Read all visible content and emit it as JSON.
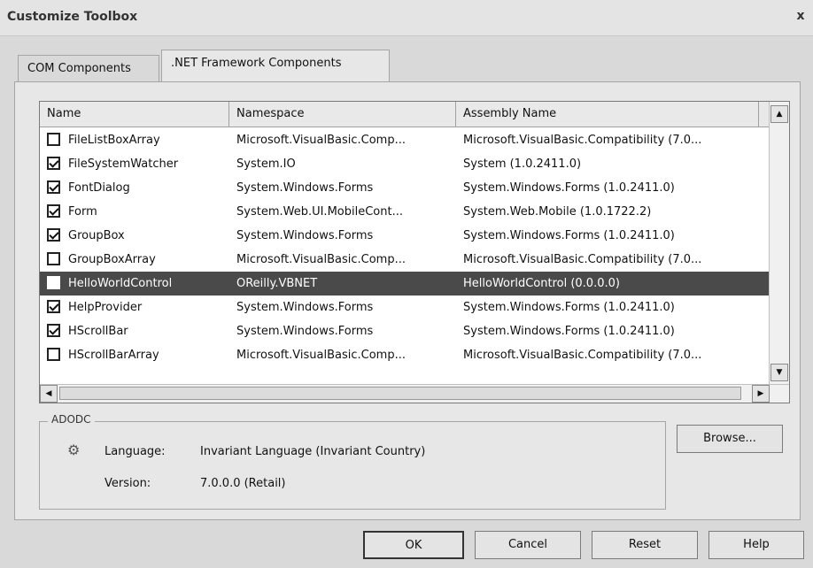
{
  "window": {
    "title": "Customize Toolbox",
    "close_glyph": "x"
  },
  "tabs": [
    {
      "label": "COM Components"
    },
    {
      "label": ".NET Framework Components"
    }
  ],
  "columns": [
    "Name",
    "Namespace",
    "Assembly Name"
  ],
  "rows": [
    {
      "checked": false,
      "selected": false,
      "name": "FileListBoxArray",
      "namespace": "Microsoft.VisualBasic.Comp...",
      "assembly": "Microsoft.VisualBasic.Compatibility (7.0..."
    },
    {
      "checked": true,
      "selected": false,
      "name": "FileSystemWatcher",
      "namespace": "System.IO",
      "assembly": "System (1.0.2411.0)"
    },
    {
      "checked": true,
      "selected": false,
      "name": "FontDialog",
      "namespace": "System.Windows.Forms",
      "assembly": "System.Windows.Forms (1.0.2411.0)"
    },
    {
      "checked": true,
      "selected": false,
      "name": "Form",
      "namespace": "System.Web.UI.MobileCont...",
      "assembly": "System.Web.Mobile (1.0.1722.2)"
    },
    {
      "checked": true,
      "selected": false,
      "name": "GroupBox",
      "namespace": "System.Windows.Forms",
      "assembly": "System.Windows.Forms (1.0.2411.0)"
    },
    {
      "checked": false,
      "selected": false,
      "name": "GroupBoxArray",
      "namespace": "Microsoft.VisualBasic.Comp...",
      "assembly": "Microsoft.VisualBasic.Compatibility (7.0..."
    },
    {
      "checked": false,
      "selected": true,
      "name": "HelloWorldControl",
      "namespace": "OReilly.VBNET",
      "assembly": "HelloWorldControl (0.0.0.0)"
    },
    {
      "checked": true,
      "selected": false,
      "name": "HelpProvider",
      "namespace": "System.Windows.Forms",
      "assembly": "System.Windows.Forms (1.0.2411.0)"
    },
    {
      "checked": true,
      "selected": false,
      "name": "HScrollBar",
      "namespace": "System.Windows.Forms",
      "assembly": "System.Windows.Forms (1.0.2411.0)"
    },
    {
      "checked": false,
      "selected": false,
      "name": "HScrollBarArray",
      "namespace": "Microsoft.VisualBasic.Comp...",
      "assembly": "Microsoft.VisualBasic.Compatibility (7.0..."
    }
  ],
  "info": {
    "group_title": "ADODC",
    "language_label": "Language:",
    "language_value": "Invariant Language (Invariant Country)",
    "version_label": "Version:",
    "version_value": "7.0.0.0 (Retail)"
  },
  "buttons": {
    "browse": "Browse...",
    "ok": "OK",
    "cancel": "Cancel",
    "reset": "Reset",
    "help": "Help"
  },
  "icons": {
    "info_icon": "gear-icon",
    "scroll_up": "arrow-up-icon",
    "scroll_down": "arrow-down-icon",
    "scroll_left": "arrow-left-icon",
    "scroll_right": "arrow-right-icon"
  }
}
